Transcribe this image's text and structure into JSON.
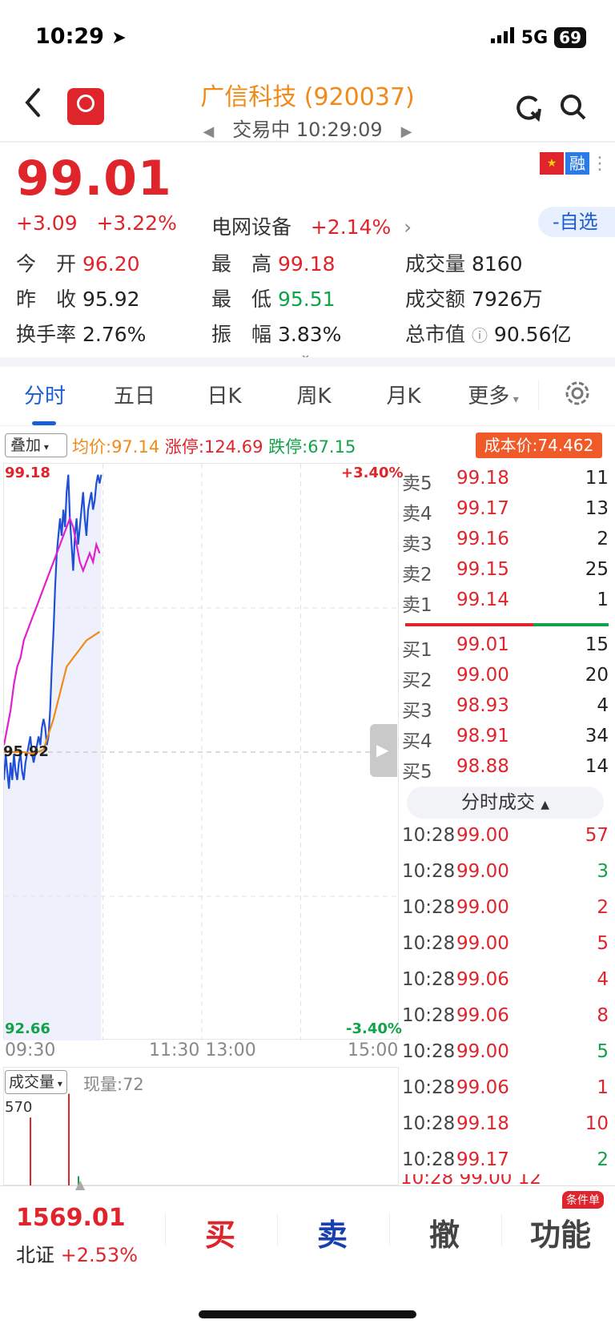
{
  "status": {
    "time": "10:29",
    "network": "5G",
    "battery": "69"
  },
  "header": {
    "title": "广信科技 (920037)",
    "subtitle": "交易中 10:29:09"
  },
  "quote": {
    "price": "99.01",
    "change": "+3.09",
    "change_pct": "+3.22%",
    "sector": "电网设备",
    "sector_pct": "+2.14%",
    "watch_btn": "-自选",
    "badge_rong": "融",
    "open_label": "今　开",
    "open": "96.20",
    "high_label": "最　高",
    "high": "99.18",
    "vol_label": "成交量",
    "vol": "8160",
    "prev_label": "昨　收",
    "prev": "95.92",
    "low_label": "最　低",
    "low": "95.51",
    "amount_label": "成交额",
    "amount": "7926万",
    "turnover_label": "换手率",
    "turnover": "2.76%",
    "amp_label": "振　幅",
    "amp": "3.83%",
    "mcap_label": "总市值",
    "mcap": "90.56亿"
  },
  "tabs": [
    "分时",
    "五日",
    "日K",
    "周K",
    "月K",
    "更多"
  ],
  "chart_header": {
    "overlay_btn": "叠加",
    "avg": "均价:97.14",
    "limit_up": "涨停:124.69",
    "limit_down": "跌停:67.15",
    "cost": "成本价:74.462"
  },
  "chart_data": {
    "type": "line",
    "y_top_label": "99.18",
    "y_top_pct": "+3.40%",
    "y_mid_label": "95.92",
    "y_bottom_label": "92.66",
    "y_bottom_pct": "-3.40%",
    "x_ticks": [
      "09:30",
      "11:30 13:00",
      "15:00"
    ],
    "ylim": [
      92.66,
      99.18
    ],
    "series": [
      {
        "color": "#1f4fd6",
        "x": [
          0,
          1,
          2,
          3,
          4,
          5,
          6,
          7,
          8,
          9,
          10,
          11,
          12,
          13,
          14,
          15,
          16,
          17,
          18,
          19,
          20,
          21,
          22,
          23,
          24,
          25,
          26,
          27,
          28,
          29,
          30,
          31,
          32,
          33,
          34,
          35,
          36,
          37,
          38,
          39,
          40,
          41,
          42,
          43,
          44,
          45,
          46,
          47,
          48,
          49,
          50,
          51,
          52,
          53,
          54,
          55,
          56,
          57,
          58,
          59
        ],
        "values": [
          95.6,
          95.9,
          95.7,
          95.5,
          95.8,
          95.6,
          95.9,
          95.7,
          95.6,
          95.8,
          95.9,
          95.7,
          95.6,
          95.8,
          95.9,
          96.0,
          96.1,
          95.9,
          95.8,
          95.9,
          96.0,
          96.1,
          96.0,
          96.2,
          96.3,
          96.2,
          96.0,
          96.1,
          96.4,
          96.9,
          97.3,
          97.8,
          98.2,
          98.4,
          98.6,
          98.4,
          98.7,
          98.5,
          98.9,
          99.1,
          98.6,
          98.3,
          98.0,
          98.4,
          98.6,
          98.3,
          98.5,
          98.7,
          98.9,
          98.6,
          98.4,
          98.7,
          98.8,
          98.9,
          98.7,
          98.8,
          99.0,
          99.1,
          99.0,
          99.1
        ]
      },
      {
        "color": "#e020d0",
        "x": [
          0,
          2,
          4,
          6,
          8,
          10,
          12,
          14,
          16,
          18,
          20,
          22,
          24,
          26,
          28,
          30,
          32,
          34,
          36,
          38,
          40,
          42,
          44,
          46,
          48,
          50,
          52,
          54,
          56,
          58
        ],
        "values": [
          96.0,
          96.2,
          96.4,
          96.7,
          96.9,
          97.0,
          97.2,
          97.3,
          97.4,
          97.5,
          97.6,
          97.7,
          97.8,
          97.9,
          98.0,
          98.1,
          98.2,
          98.3,
          98.4,
          98.5,
          98.6,
          98.5,
          98.3,
          98.1,
          98.0,
          98.1,
          98.2,
          98.1,
          98.3,
          98.2
        ]
      },
      {
        "color": "#f08a18",
        "x": [
          0,
          6,
          12,
          18,
          24,
          30,
          34,
          38,
          42,
          46,
          50,
          54,
          58
        ],
        "values": [
          95.92,
          95.92,
          95.92,
          95.9,
          95.95,
          96.3,
          96.6,
          96.9,
          97.0,
          97.1,
          97.2,
          97.25,
          97.3
        ]
      }
    ]
  },
  "volume": {
    "label": "成交量",
    "current": "现量:72",
    "max": "570"
  },
  "order_book": {
    "asks": [
      {
        "k": "卖5",
        "p": "99.18",
        "v": "11"
      },
      {
        "k": "卖4",
        "p": "99.17",
        "v": "13"
      },
      {
        "k": "卖3",
        "p": "99.16",
        "v": "2"
      },
      {
        "k": "卖2",
        "p": "99.15",
        "v": "25"
      },
      {
        "k": "卖1",
        "p": "99.14",
        "v": "1"
      }
    ],
    "bids": [
      {
        "k": "买1",
        "p": "99.01",
        "v": "15"
      },
      {
        "k": "买2",
        "p": "99.00",
        "v": "20"
      },
      {
        "k": "买3",
        "p": "98.93",
        "v": "4"
      },
      {
        "k": "买4",
        "p": "98.91",
        "v": "34"
      },
      {
        "k": "买5",
        "p": "98.88",
        "v": "14"
      }
    ],
    "trades_title": "分时成交",
    "trades": [
      {
        "t": "10:28",
        "p": "99.00",
        "v": "57",
        "c": "red"
      },
      {
        "t": "10:28",
        "p": "99.00",
        "v": "3",
        "c": "green"
      },
      {
        "t": "10:28",
        "p": "99.00",
        "v": "2",
        "c": "red"
      },
      {
        "t": "10:28",
        "p": "99.00",
        "v": "5",
        "c": "red"
      },
      {
        "t": "10:28",
        "p": "99.06",
        "v": "4",
        "c": "red"
      },
      {
        "t": "10:28",
        "p": "99.06",
        "v": "8",
        "c": "red"
      },
      {
        "t": "10:28",
        "p": "99.00",
        "v": "5",
        "c": "green"
      },
      {
        "t": "10:28",
        "p": "99.06",
        "v": "1",
        "c": "red"
      },
      {
        "t": "10:28",
        "p": "99.18",
        "v": "10",
        "c": "red"
      },
      {
        "t": "10:28",
        "p": "99.17",
        "v": "2",
        "c": "green"
      }
    ]
  },
  "bottom": {
    "index": "1569.01",
    "index_name": "北证",
    "index_pct": "+2.53%",
    "buy": "买",
    "sell": "卖",
    "cancel": "撤",
    "func": "功能",
    "cond_tag": "条件单"
  }
}
